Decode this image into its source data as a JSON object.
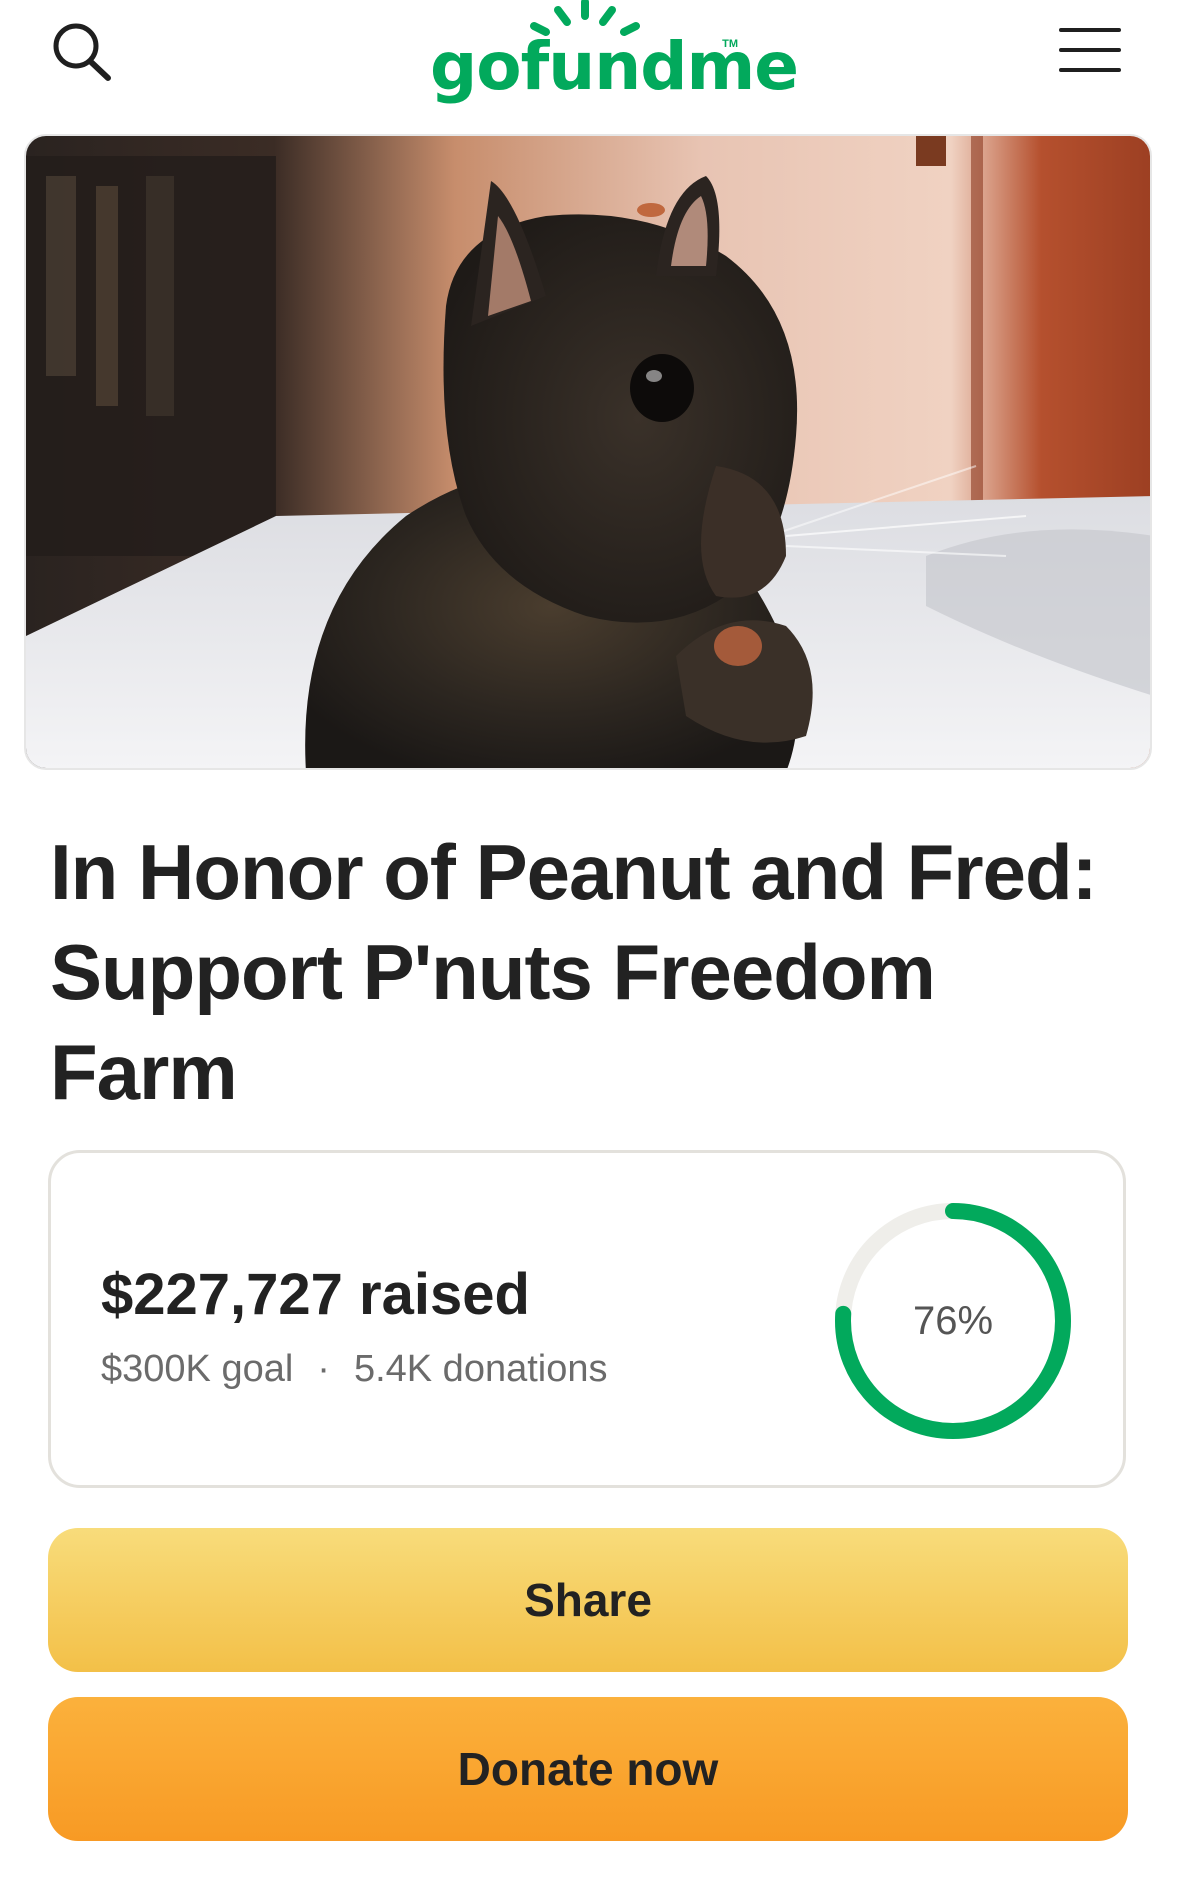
{
  "header": {
    "logo_text": "gofundme",
    "logo_tm": "TM"
  },
  "campaign": {
    "image_alt": "Squirrel eating a nut on a bed",
    "title": "In Honor of Peanut and Fred: Support P'nuts Freedom Farm"
  },
  "progress": {
    "raised": "$227,727 raised",
    "goal": "$300K goal",
    "separator": "·",
    "donations": "5.4K donations",
    "percent_label": "76%",
    "percent_value": 0.76
  },
  "actions": {
    "share_label": "Share",
    "donate_label": "Donate now"
  },
  "colors": {
    "brand_green": "#02a95c",
    "share_yellow": "#f6cf5e",
    "donate_orange": "#f9a52e"
  },
  "icons": {
    "search": "search-icon",
    "menu": "hamburger-menu-icon"
  }
}
